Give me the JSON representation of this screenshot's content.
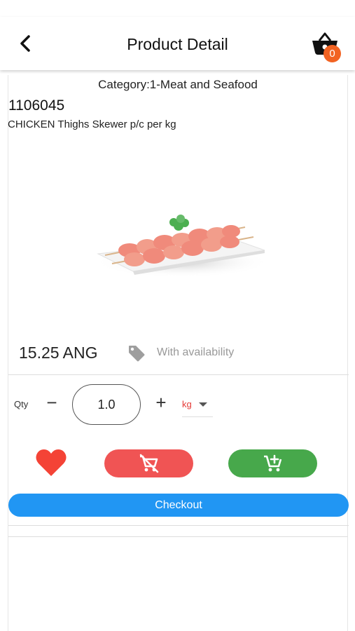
{
  "header": {
    "title": "Product Detail",
    "back_icon": "chevron-left-icon",
    "cart_icon": "basket-icon",
    "cart_count": "0"
  },
  "product": {
    "category": "Category:1-Meat and Seafood",
    "code": "1106045",
    "name": "CHICKEN Thighs Skewer p/c per kg",
    "price": "15.25 ANG",
    "availability": "With availability"
  },
  "quantity": {
    "label": "Qty",
    "minus": "−",
    "value": "1.0",
    "plus": "+",
    "unit": "kg"
  },
  "actions": {
    "checkout_label": "Checkout"
  },
  "colors": {
    "accent": "#2196f3",
    "badge": "#f26322",
    "remove": "#f05454",
    "add": "#47a84b",
    "favorite": "#f44336"
  }
}
